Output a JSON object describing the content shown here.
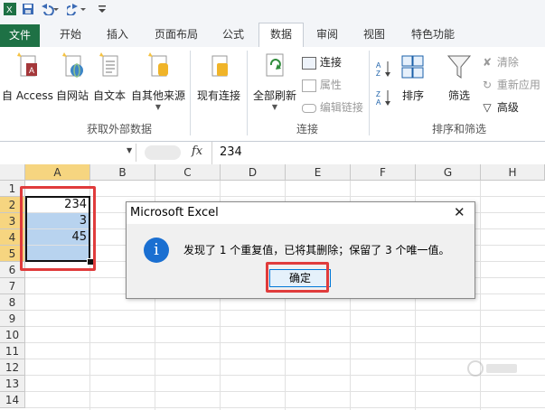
{
  "ribbon_tabs": [
    "文件",
    "开始",
    "插入",
    "页面布局",
    "公式",
    "数据",
    "审阅",
    "视图",
    "特色功能"
  ],
  "active_tab": "数据",
  "ribbon": {
    "external": {
      "access": "自 Access",
      "web": "自网站",
      "text": "自文本",
      "other": "自其他来源",
      "existing": "现有连接",
      "group": "获取外部数据"
    },
    "connections": {
      "refresh_all": "全部刷新",
      "connections": "连接",
      "properties": "属性",
      "edit_links": "编辑链接",
      "group": "连接"
    },
    "sort_filter": {
      "sort": "排序",
      "filter": "筛选",
      "clear": "清除",
      "reapply": "重新应用",
      "advanced": "高级",
      "group": "排序和筛选"
    }
  },
  "formula_bar": {
    "fx": "fx",
    "value": "234"
  },
  "columns": [
    "A",
    "B",
    "C",
    "D",
    "E",
    "F",
    "G",
    "H"
  ],
  "rows": [
    "1",
    "2",
    "3",
    "4",
    "5",
    "6",
    "7",
    "8",
    "9",
    "10",
    "11",
    "12",
    "13",
    "14"
  ],
  "cells": {
    "A2": "234",
    "A3": "3",
    "A4": "45"
  },
  "dialog": {
    "title": "Microsoft Excel",
    "close": "✕",
    "info_glyph": "i",
    "message": "发现了 1 个重复值，已将其删除；保留了 3 个唯一值。",
    "ok": "确定"
  },
  "colors": {
    "file_tab": "#1e7145",
    "selection": "#b8d3ef",
    "highlight": "#e03c3c",
    "info_icon": "#1a6fd1"
  }
}
